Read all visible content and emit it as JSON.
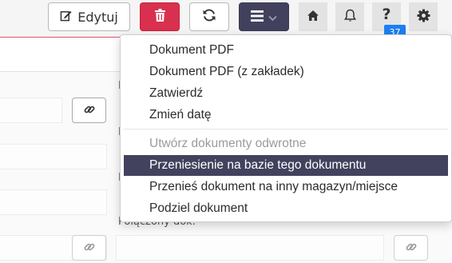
{
  "toolbar": {
    "edit_label": "Edytuj",
    "help_badge": "37",
    "icons": [
      "edit-icon",
      "trash-icon",
      "refresh-icon",
      "hamburger-menu-icon",
      "chevron-down-icon",
      "home-icon",
      "bell-icon",
      "help-icon",
      "gear-icon"
    ],
    "colors": {
      "delete": "#d9304f",
      "menu": "#42415d",
      "badge": "#1c7ff2"
    }
  },
  "page": {
    "label_m": "M",
    "label_d1": "D",
    "label_d2": "D",
    "label_polaczony": "Połączony dok."
  },
  "dropdown": {
    "items": [
      {
        "label": "Dokument PDF",
        "state": "normal"
      },
      {
        "label": "Dokument PDF (z zakładek)",
        "state": "normal"
      },
      {
        "label": "Zatwierdź",
        "state": "normal"
      },
      {
        "label": "Zmień datę",
        "state": "normal"
      },
      {
        "label": "Utwórz dokumenty odwrotne",
        "state": "disabled"
      },
      {
        "label": "Przeniesienie na bazie tego dokumentu",
        "state": "active"
      },
      {
        "label": "Przenieś dokument na inny magazyn/miejsce",
        "state": "normal"
      },
      {
        "label": "Podziel dokument",
        "state": "normal"
      }
    ],
    "active_color": "#43425e"
  }
}
